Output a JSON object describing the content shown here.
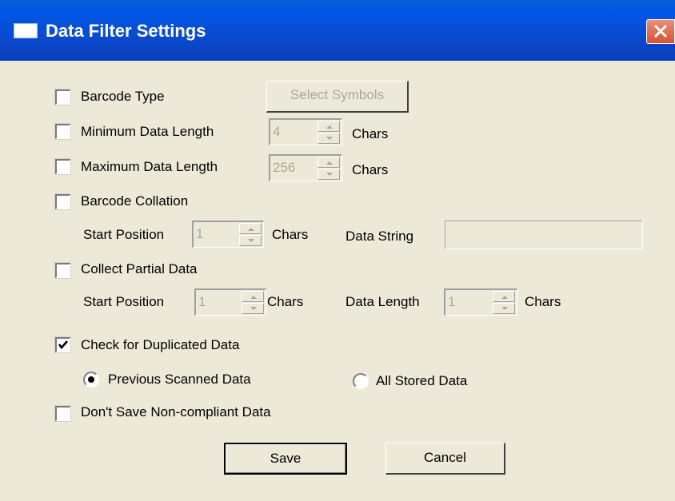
{
  "window": {
    "title": "Data Filter Settings",
    "close_icon": "close-x-icon",
    "title_icon": "window-icon",
    "colors": {
      "titlebar": "#0058e6",
      "dialog_bg": "#ece9d8",
      "close": "#d8502e"
    }
  },
  "filters": {
    "barcode_type": {
      "label": "Barcode Type",
      "checked": false,
      "button": "Select Symbols"
    },
    "min_length": {
      "label": "Minimum Data Length",
      "checked": false,
      "value": "4",
      "unit": "Chars"
    },
    "max_length": {
      "label": "Maximum Data Length",
      "checked": false,
      "value": "256",
      "unit": "Chars"
    },
    "collation": {
      "label": "Barcode Collation",
      "checked": false,
      "start_label": "Start Position",
      "start_value": "1",
      "start_unit": "Chars",
      "string_label": "Data String",
      "string_value": ""
    },
    "partial": {
      "label": "Collect Partial Data",
      "checked": false,
      "start_label": "Start Position",
      "start_value": "1",
      "start_unit": "Chars",
      "length_label": "Data Length",
      "length_value": "1",
      "length_unit": "Chars"
    },
    "duplicates": {
      "label": "Check for Duplicated Data",
      "checked": true,
      "option_previous": "Previous Scanned Data",
      "option_all": "All Stored Data",
      "selected": "Previous Scanned Data"
    },
    "noncompliant": {
      "label": "Don't Save Non-compliant Data",
      "checked": false
    }
  },
  "buttons": {
    "save": "Save",
    "cancel": "Cancel"
  }
}
